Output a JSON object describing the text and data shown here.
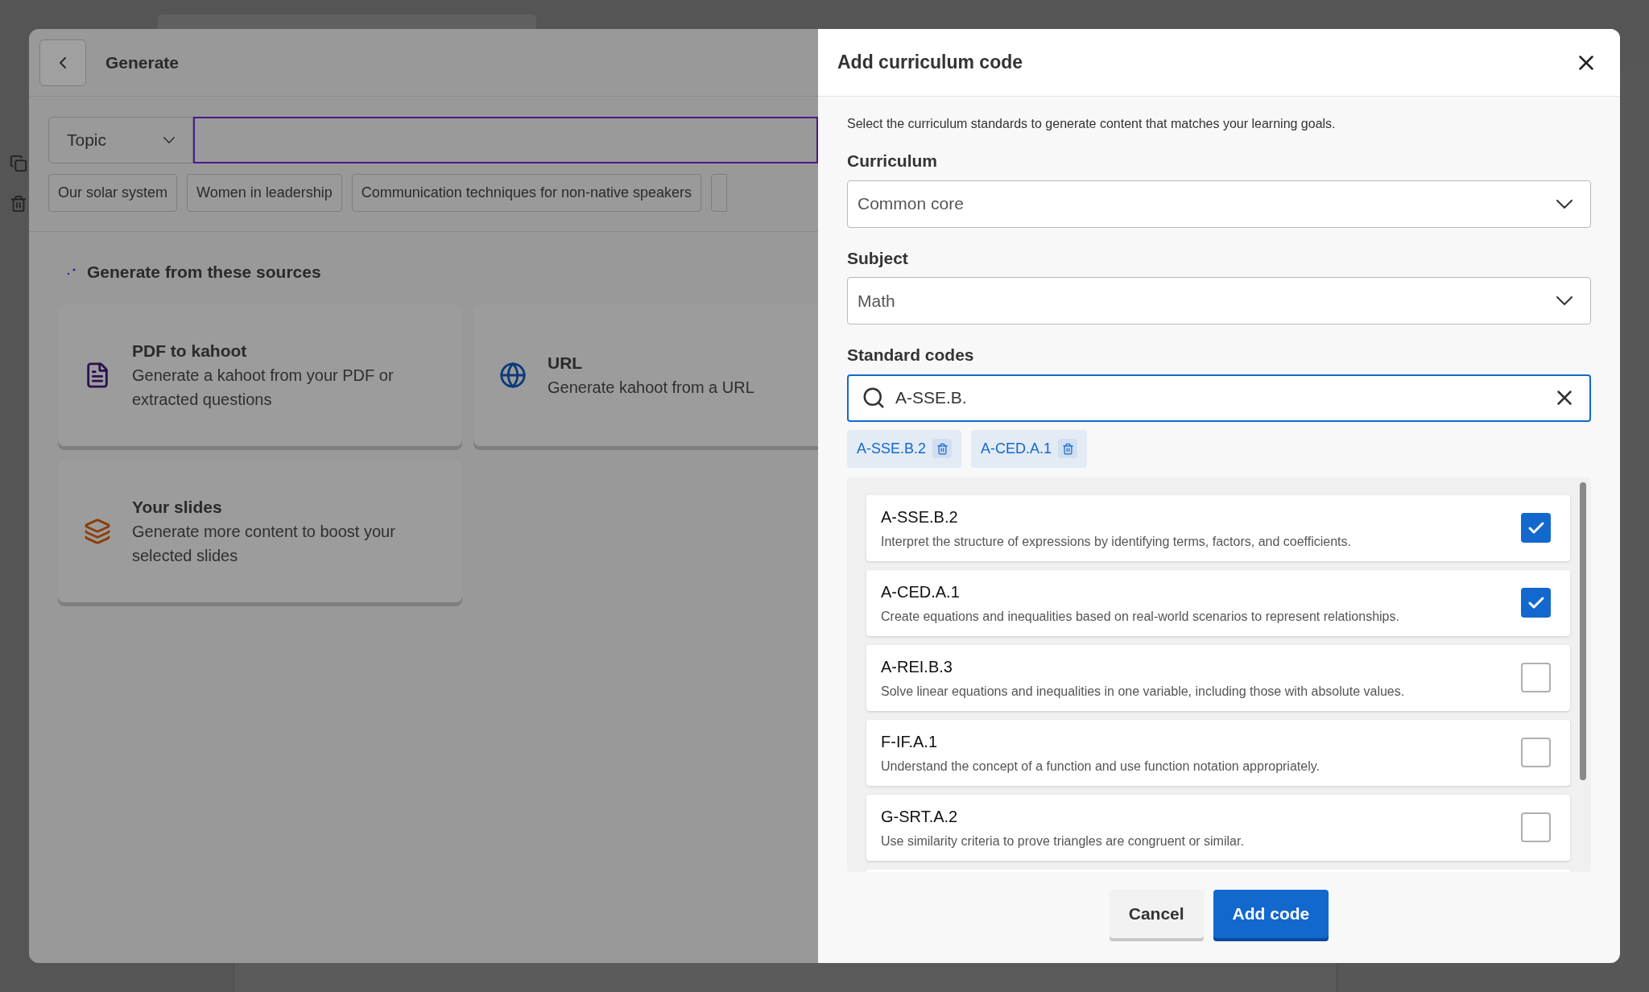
{
  "generate_panel": {
    "title": "Generate",
    "topic_select": {
      "value": "Topic"
    },
    "suggestions": [
      "Our solar system",
      "Women in leadership",
      "Communication techniques for non-native speakers"
    ],
    "sources_heading": "Generate from these sources",
    "sources": [
      {
        "kind": "pdf",
        "title": "PDF to kahoot",
        "description": "Generate a kahoot from your PDF or extracted questions"
      },
      {
        "kind": "url",
        "title": "URL",
        "description": "Generate kahoot from a URL"
      },
      {
        "kind": "slides",
        "title": "Your slides",
        "description": "Generate more content to boost your selected slides"
      }
    ]
  },
  "dialog": {
    "title": "Add curriculum code",
    "intro": "Select the curriculum standards to generate content that matches your learning goals.",
    "curriculum": {
      "label": "Curriculum",
      "value": "Common core"
    },
    "subject": {
      "label": "Subject",
      "value": "Math"
    },
    "standard_codes": {
      "label": "Standard codes",
      "search_value": "A-SSE.B.",
      "selected_tags": [
        "A-SSE.B.2",
        "A-CED.A.1"
      ],
      "options": [
        {
          "code": "A-SSE.B.2",
          "description": "Interpret the structure of expressions by identifying terms, factors, and coefficients.",
          "checked": true
        },
        {
          "code": "A-CED.A.1",
          "description": "Create equations and inequalities based on real-world scenarios to represent relationships.",
          "checked": true
        },
        {
          "code": "A-REI.B.3",
          "description": "Solve linear equations and inequalities in one variable, including those with absolute values.",
          "checked": false
        },
        {
          "code": "F-IF.A.1",
          "description": "Understand the concept of a function and use function notation appropriately.",
          "checked": false
        },
        {
          "code": "G-SRT.A.2",
          "description": "Use similarity criteria to prove triangles are congruent or similar.",
          "checked": false
        }
      ]
    },
    "buttons": [
      {
        "kind": "secondary",
        "label": "Cancel"
      },
      {
        "kind": "primary",
        "label": "Add code"
      }
    ]
  }
}
